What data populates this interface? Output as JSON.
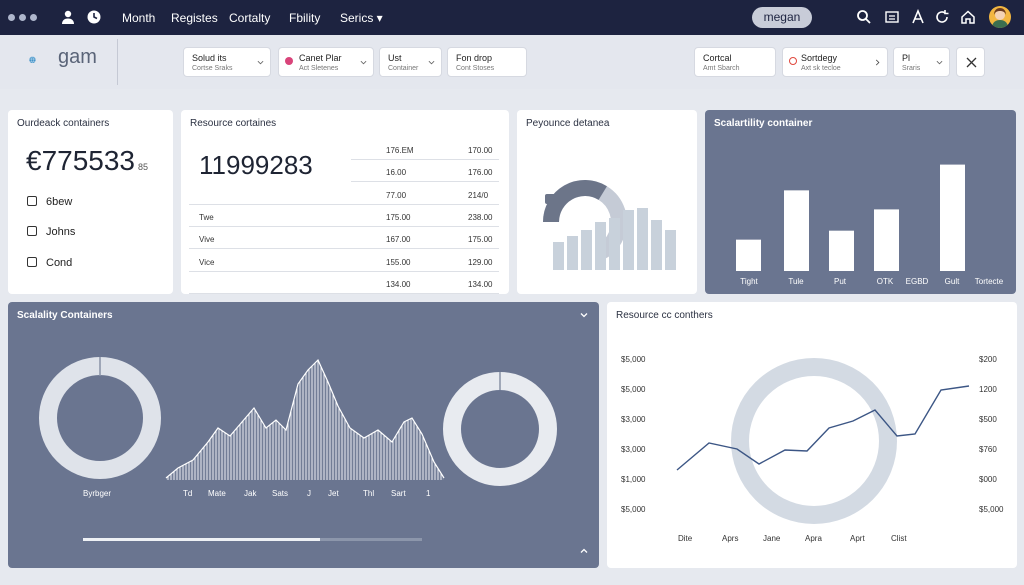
{
  "nav": {
    "items": [
      "Month",
      "Registes",
      "Cortalty",
      "Fbility",
      "Serics"
    ],
    "user": "megan"
  },
  "filters": {
    "logo_text": "gam",
    "chips": [
      {
        "line1": "Solud its",
        "line2": "Cortse Sraks"
      },
      {
        "line1": "Canet Plar",
        "line2": "Act Sletenes"
      },
      {
        "line1": "Ust",
        "line2": "Container"
      },
      {
        "line1": "Fon drop",
        "line2": "Cont Stoses"
      },
      {
        "line1": "Cortcal",
        "line2": "Amt Sbarch"
      },
      {
        "line1": "Sortdegy",
        "line2": "Axt sk tecloe"
      },
      {
        "line1": "Pl",
        "line2": "Sraris"
      }
    ]
  },
  "card_outback": {
    "title": "Ourdeack containers",
    "value": "€775533",
    "unit": "85",
    "options": [
      "6bew",
      "Johns",
      "Cond"
    ]
  },
  "card_resource": {
    "title": "Resource cortaines",
    "value": "11999283",
    "rows": [
      {
        "label": "",
        "a": "176.EM",
        "b": "170.00"
      },
      {
        "label": "",
        "a": "16.00",
        "b": "176.00"
      },
      {
        "label": "",
        "a": "77.00",
        "b": "214/0"
      },
      {
        "label": "Twe",
        "a": "175.00",
        "b": "238.00"
      },
      {
        "label": "Vive",
        "a": "167.00",
        "b": "175.00"
      },
      {
        "label": "Vice",
        "a": "155.00",
        "b": "129.00"
      },
      {
        "label": "",
        "a": "134.00",
        "b": "134.00"
      }
    ]
  },
  "card_performance": {
    "title": "Peyounce detanea",
    "gauge_fraction": 0.5
  },
  "card_scalability_bars": {
    "title": "Scalartility container",
    "chart_data": {
      "type": "bar",
      "categories": [
        "Tight",
        "Tule",
        "Put",
        "OTK",
        "EGBD",
        "Gult",
        "Tortecte"
      ],
      "values": [
        28,
        72,
        36,
        55,
        0,
        95,
        0
      ],
      "ylim": [
        0,
        100
      ]
    }
  },
  "card_scalability_main": {
    "title": "Scalality Containers",
    "left_donut_label": "Byrbger",
    "x_labels": [
      "Td",
      "Mate",
      "Jak",
      "Sats",
      "J",
      "Jet",
      "Thl",
      "Sart",
      "1"
    ],
    "progress_fraction": 0.7
  },
  "card_resource_line": {
    "title": "Resource cc conthers",
    "chart_data": {
      "type": "line",
      "x": [
        "Dite",
        "Aprs",
        "Jane",
        "Apra",
        "Aprt",
        "Clist"
      ],
      "left_ticks": [
        "$5,000",
        "$5,000",
        "$3,000",
        "$3,000",
        "$1,000",
        "$5,000"
      ],
      "right_ticks": [
        "$200",
        "1200",
        "$500",
        "$760",
        "$000",
        "$5,000"
      ]
    }
  }
}
